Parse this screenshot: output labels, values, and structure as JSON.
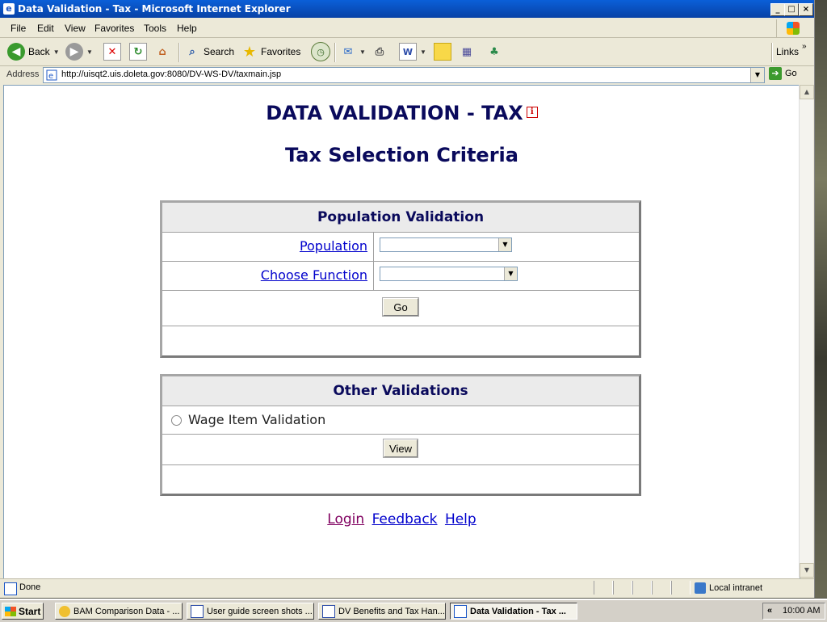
{
  "window": {
    "title": "Data Validation - Tax - Microsoft Internet Explorer",
    "controls": [
      "_",
      "□",
      "×"
    ]
  },
  "menu": [
    "File",
    "Edit",
    "View",
    "Favorites",
    "Tools",
    "Help"
  ],
  "toolbar": {
    "back_label": "Back",
    "search_label": "Search",
    "favorites_label": "Favorites",
    "links_label": "Links"
  },
  "address": {
    "label": "Address",
    "url": "http://uisqt2.uis.doleta.gov:8080/DV-WS-DV/taxmain.jsp",
    "go_label": "Go"
  },
  "page": {
    "title": "DATA VALIDATION - TAX",
    "info_icon_text": "i",
    "subtitle": "Tax Selection Criteria",
    "population_panel": {
      "header": "Population Validation",
      "population_label": "Population",
      "population_value": "",
      "function_label": "Choose Function",
      "function_value": "",
      "go_button": "Go"
    },
    "other_panel": {
      "header": "Other Validations",
      "option_label": "Wage Item Validation",
      "view_button": "View"
    },
    "links": {
      "login": "Login",
      "feedback": "Feedback",
      "help": "Help"
    }
  },
  "status": {
    "text": "Done",
    "zone": "Local intranet"
  },
  "taskbar": {
    "start": "Start",
    "tasks": [
      {
        "label": "BAM Comparison Data - ..."
      },
      {
        "label": "User guide screen shots ..."
      },
      {
        "label": "DV Benefits and Tax Han..."
      },
      {
        "label": "Data Validation - Tax ..."
      }
    ],
    "tray_chevron": "«",
    "clock": "10:00 AM"
  },
  "colors": {
    "title_bar": "#0a55c8",
    "heading_text": "#0a0a5c",
    "link": "#0000cc",
    "visited_link": "#800060",
    "panel_header_bg": "#ebebeb"
  }
}
